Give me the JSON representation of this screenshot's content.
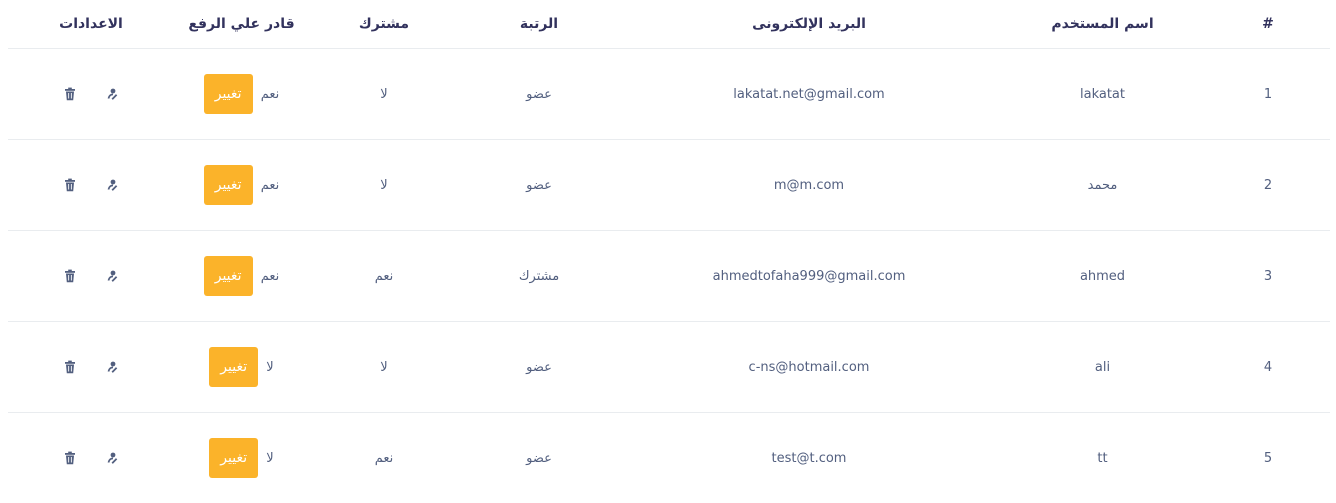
{
  "table": {
    "headers": [
      "#",
      "اسم المستخدم",
      "البريد الإلكترونى",
      "الرتبة",
      "مشترك",
      "قادر علي الرفع",
      "الاعدادات"
    ],
    "change_label": "تغيير",
    "rows": [
      {
        "num": "1",
        "username": "lakatat",
        "email": "lakatat.net@gmail.com",
        "rank": "عضو",
        "subscribed": "لا",
        "can_upload": "نعم"
      },
      {
        "num": "2",
        "username": "محمد",
        "email": "m@m.com",
        "rank": "عضو",
        "subscribed": "لا",
        "can_upload": "نعم"
      },
      {
        "num": "3",
        "username": "ahmed",
        "email": "ahmedtofaha999@gmail.com",
        "rank": "مشترك",
        "subscribed": "نعم",
        "can_upload": "نعم"
      },
      {
        "num": "4",
        "username": "ali",
        "email": "c-ns@hotmail.com",
        "rank": "عضو",
        "subscribed": "لا",
        "can_upload": "لا"
      },
      {
        "num": "5",
        "username": "tt",
        "email": "test@t.com",
        "rank": "عضو",
        "subscribed": "نعم",
        "can_upload": "لا"
      }
    ]
  },
  "colors": {
    "accent": "#fbb32a",
    "text": "#525f7f",
    "heading": "#32325d",
    "divider": "#e9ecef"
  },
  "icons": {
    "edit": "user-edit-icon",
    "delete": "trash-icon"
  }
}
